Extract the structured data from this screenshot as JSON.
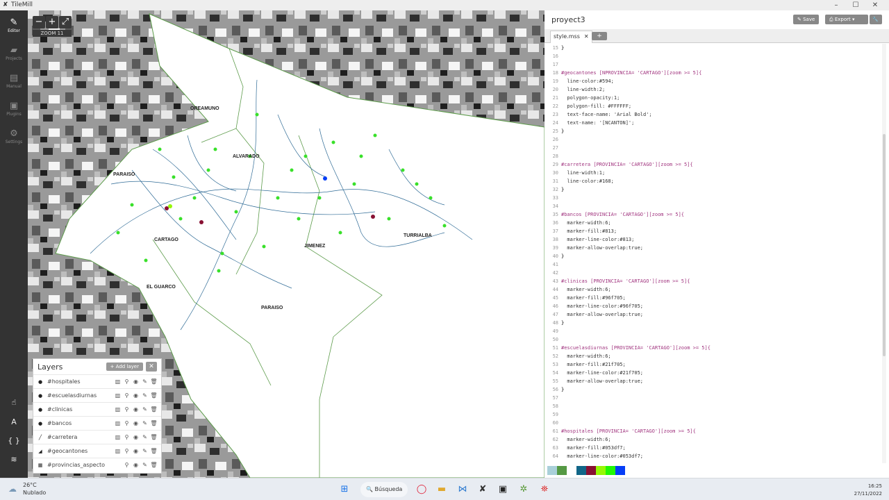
{
  "window": {
    "title": "TileMill"
  },
  "sidebar": {
    "items": [
      {
        "label": "Editor",
        "icon": "pencil-icon",
        "active": true
      },
      {
        "label": "Projects",
        "icon": "folder-icon",
        "active": false
      },
      {
        "label": "Manual",
        "icon": "book-icon",
        "active": false
      },
      {
        "label": "Plugins",
        "icon": "plugin-icon",
        "active": false
      },
      {
        "label": "Settings",
        "icon": "gear-icon",
        "active": false
      }
    ]
  },
  "map": {
    "zoom_label": "ZOOM 11",
    "place_labels": [
      "OREAMUNO",
      "ALVARADO",
      "PARAISO",
      "CARTAGO",
      "JIMENEZ",
      "TURRIALBA",
      "EL GUARCO",
      "PARAISO"
    ]
  },
  "layers": {
    "title": "Layers",
    "add_label": "Add layer",
    "items": [
      {
        "name": "#hospitales",
        "type": "point"
      },
      {
        "name": "#escuelasdiurnas",
        "type": "point"
      },
      {
        "name": "#clinicas",
        "type": "point"
      },
      {
        "name": "#bancos",
        "type": "point"
      },
      {
        "name": "#carretera",
        "type": "line"
      },
      {
        "name": "#geocantones",
        "type": "polygon"
      },
      {
        "name": "#provincias_aspecto",
        "type": "raster"
      }
    ]
  },
  "editor": {
    "project_title": "proyect3",
    "save_label": "Save",
    "export_label": "Export",
    "tab_label": "style.mss",
    "lines": [
      {
        "n": "15",
        "t": "}"
      },
      {
        "n": "16",
        "t": ""
      },
      {
        "n": "17",
        "t": ""
      },
      {
        "n": "18",
        "t": "#geocantones [NPROVINCIA= 'CARTAGO'][zoom >= 5]{"
      },
      {
        "n": "19",
        "t": "  line-color:#594;"
      },
      {
        "n": "20",
        "t": "  line-width:2;"
      },
      {
        "n": "21",
        "t": "  polygon-opacity:1;"
      },
      {
        "n": "22",
        "t": "  polygon-fill: #FFFFFF;"
      },
      {
        "n": "23",
        "t": "  text-face-name: 'Arial Bold';"
      },
      {
        "n": "24",
        "t": "  text-name: '[NCANTON]';"
      },
      {
        "n": "25",
        "t": "}"
      },
      {
        "n": "26",
        "t": ""
      },
      {
        "n": "27",
        "t": ""
      },
      {
        "n": "28",
        "t": ""
      },
      {
        "n": "29",
        "t": "#carretera [PROVINCIA= 'CARTAGO'][zoom >= 5]{"
      },
      {
        "n": "30",
        "t": "  line-width:1;"
      },
      {
        "n": "31",
        "t": "  line-color:#168;"
      },
      {
        "n": "32",
        "t": "}"
      },
      {
        "n": "33",
        "t": ""
      },
      {
        "n": "34",
        "t": ""
      },
      {
        "n": "35",
        "t": "#bancos [PROVINCIA= 'CARTAGO'][zoom >= 5]{"
      },
      {
        "n": "36",
        "t": "  marker-width:6;"
      },
      {
        "n": "37",
        "t": "  marker-fill:#813;"
      },
      {
        "n": "38",
        "t": "  marker-line-color:#813;"
      },
      {
        "n": "39",
        "t": "  marker-allow-overlap:true;"
      },
      {
        "n": "40",
        "t": "}"
      },
      {
        "n": "41",
        "t": ""
      },
      {
        "n": "42",
        "t": ""
      },
      {
        "n": "43",
        "t": "#clinicas [PROVINCIA= 'CARTAGO'][zoom >= 5]{"
      },
      {
        "n": "44",
        "t": "  marker-width:6;"
      },
      {
        "n": "45",
        "t": "  marker-fill:#96f705;"
      },
      {
        "n": "46",
        "t": "  marker-line-color:#96f705;"
      },
      {
        "n": "47",
        "t": "  marker-allow-overlap:true;"
      },
      {
        "n": "48",
        "t": "}"
      },
      {
        "n": "49",
        "t": ""
      },
      {
        "n": "50",
        "t": ""
      },
      {
        "n": "51",
        "t": "#escuelasdiurnas [PROVINCIA= 'CARTAGO'][zoom >= 5]{"
      },
      {
        "n": "52",
        "t": "  marker-width:6;"
      },
      {
        "n": "53",
        "t": "  marker-fill:#21f705;"
      },
      {
        "n": "54",
        "t": "  marker-line-color:#21f705;"
      },
      {
        "n": "55",
        "t": "  marker-allow-overlap:true;"
      },
      {
        "n": "56",
        "t": "}"
      },
      {
        "n": "57",
        "t": ""
      },
      {
        "n": "58",
        "t": ""
      },
      {
        "n": "59",
        "t": ""
      },
      {
        "n": "60",
        "t": ""
      },
      {
        "n": "61",
        "t": "#hospitales [PROVINCIA= 'CARTAGO'][zoom >= 5]{"
      },
      {
        "n": "62",
        "t": "  marker-width:6;"
      },
      {
        "n": "63",
        "t": "  marker-fill:#053df7;"
      },
      {
        "n": "64",
        "t": "  marker-line-color:#053df7;"
      }
    ],
    "palette": [
      "#a9d0d9",
      "#559944",
      "#ffffff",
      "#116688",
      "#881133",
      "#96f705",
      "#21f705",
      "#053df7"
    ]
  },
  "taskbar": {
    "temperature": "26°C",
    "condition": "Nublado",
    "search_label": "Búsqueda",
    "time": "16:25",
    "date": "27/11/2022"
  }
}
